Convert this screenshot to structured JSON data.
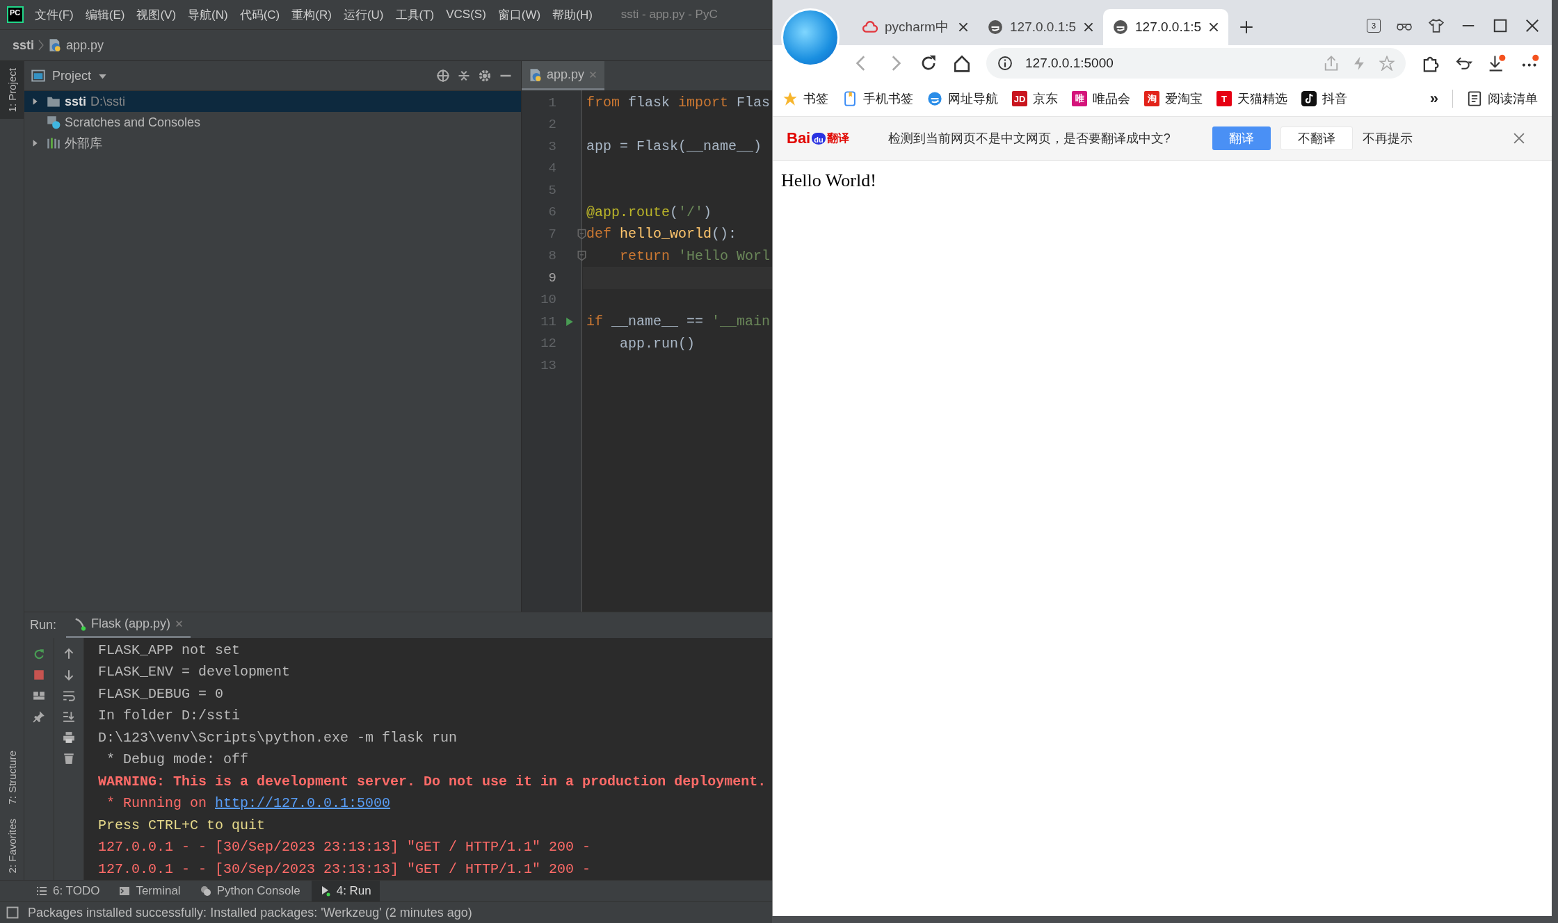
{
  "ide": {
    "logo": "PC",
    "menu": [
      "文件(F)",
      "编辑(E)",
      "视图(V)",
      "导航(N)",
      "代码(C)",
      "重构(R)",
      "运行(U)",
      "工具(T)",
      "VCS(S)",
      "窗口(W)",
      "帮助(H)"
    ],
    "title": "ssti - app.py - PyC",
    "breadcrumb": [
      "ssti",
      "app.py"
    ],
    "left_stripe_top": [
      {
        "label": "1: Project",
        "selected": true
      }
    ],
    "left_stripe_bottom": [
      {
        "label": "7: Structure",
        "selected": false
      },
      {
        "label": "2: Favorites",
        "selected": false
      }
    ],
    "project": {
      "title": "Project",
      "tree": [
        {
          "kind": "folder",
          "name": "ssti",
          "path": "D:\\ssti",
          "expanded": false,
          "selected": true
        },
        {
          "kind": "scratches",
          "name": "Scratches and Consoles",
          "selected": false
        },
        {
          "kind": "library",
          "name": "外部库",
          "expanded": false,
          "selected": false
        }
      ]
    },
    "editor": {
      "tab": "app.py",
      "lines": [
        {
          "kind": "plain",
          "number": "1",
          "current": false,
          "tokens": [
            {
              "kind": "keyword",
              "text": "from"
            },
            {
              "kind": "plain",
              "text": " flask "
            },
            {
              "kind": "keyword",
              "text": "import"
            },
            {
              "kind": "plain",
              "text": " Flas"
            }
          ]
        },
        {
          "kind": "plain",
          "number": "2",
          "current": false
        },
        {
          "kind": "plain",
          "number": "3",
          "current": false,
          "tokens": [
            {
              "kind": "plain",
              "text": "app = Flask(__name__)"
            }
          ]
        },
        {
          "kind": "plain",
          "number": "4",
          "current": false
        },
        {
          "kind": "plain",
          "number": "5",
          "current": false
        },
        {
          "kind": "plain",
          "number": "6",
          "current": false,
          "tokens": [
            {
              "kind": "decorator",
              "text": "@app.route"
            },
            {
              "kind": "plain",
              "text": "("
            },
            {
              "kind": "string",
              "text": "'/'"
            },
            {
              "kind": "plain",
              "text": ")"
            }
          ]
        },
        {
          "kind": "fold",
          "number": "7",
          "current": false,
          "tokens": [
            {
              "kind": "keyword",
              "text": "def "
            },
            {
              "kind": "function",
              "text": "hello_world"
            },
            {
              "kind": "plain",
              "text": "():"
            }
          ]
        },
        {
          "kind": "fold",
          "number": "8",
          "current": false,
          "tokens": [
            {
              "kind": "keyword",
              "text": "    return "
            },
            {
              "kind": "string",
              "text": "'Hello Worl"
            }
          ]
        },
        {
          "kind": "plain",
          "number": "9",
          "current": true
        },
        {
          "kind": "plain",
          "number": "10",
          "current": false
        },
        {
          "kind": "run",
          "number": "11",
          "current": false,
          "tokens": [
            {
              "kind": "keyword",
              "text": "if"
            },
            {
              "kind": "plain",
              "text": " __name__ == "
            },
            {
              "kind": "string",
              "text": "'__main"
            }
          ]
        },
        {
          "kind": "plain",
          "number": "12",
          "current": false,
          "tokens": [
            {
              "kind": "plain",
              "text": "    app.run()"
            }
          ]
        },
        {
          "kind": "plain",
          "number": "13",
          "current": false
        }
      ]
    },
    "run": {
      "label": "Run:",
      "tab": "Flask (app.py)",
      "console": [
        {
          "kind": "normal",
          "text": "FLASK_APP not set"
        },
        {
          "kind": "normal",
          "text": "FLASK_ENV = development"
        },
        {
          "kind": "normal",
          "text": "FLASK_DEBUG = 0"
        },
        {
          "kind": "normal",
          "text": "In folder D:/ssti"
        },
        {
          "kind": "normal",
          "text": "D:\\123\\venv\\Scripts\\python.exe -m flask run"
        },
        {
          "kind": "normal",
          "text": " * Debug mode: off"
        },
        {
          "kind": "warning",
          "text": "WARNING: This is a development server. Do not use it in a production deployment."
        },
        {
          "kind": "running",
          "text": " * Running on ",
          "link": "http://127.0.0.1:5000"
        },
        {
          "kind": "prompt",
          "text": "Press CTRL+C to quit"
        },
        {
          "kind": "log",
          "text": "127.0.0.1 - - [30/Sep/2023 23:13:13] \"GET / HTTP/1.1\" 200 -"
        },
        {
          "kind": "log",
          "text": "127.0.0.1 - - [30/Sep/2023 23:13:13] \"GET / HTTP/1.1\" 200 -"
        }
      ]
    },
    "tool_tabs": [
      {
        "kind": "todo",
        "label": "6: TODO",
        "selected": false
      },
      {
        "kind": "terminal",
        "label": "Terminal",
        "selected": false
      },
      {
        "kind": "python",
        "label": "Python Console",
        "selected": false
      },
      {
        "kind": "run",
        "label": "4: Run",
        "selected": true
      }
    ],
    "status_bar": "Packages installed successfully: Installed packages: 'Werkzeug' (2 minutes ago)"
  },
  "browser": {
    "tabs": [
      {
        "kind": "cloud",
        "title": "pycharm中",
        "selected": false
      },
      {
        "kind": "page",
        "title": "127.0.0.1:5",
        "selected": false
      },
      {
        "kind": "page",
        "title": "127.0.0.1:5",
        "selected": true
      }
    ],
    "tab_count": "3",
    "address": "127.0.0.1:5000",
    "bookmarks": [
      {
        "kind": "star",
        "label": "书签"
      },
      {
        "kind": "phone",
        "label": "手机书签"
      },
      {
        "kind": "nav",
        "label": "网址导航"
      },
      {
        "kind": "badge",
        "icon_text": "JD",
        "color": "#c9151e",
        "label": "京东"
      },
      {
        "kind": "badge",
        "icon_text": "唯",
        "color": "#d4147a",
        "label": "唯品会"
      },
      {
        "kind": "badge",
        "icon_text": "淘",
        "color": "#e2231a",
        "label": "爱淘宝"
      },
      {
        "kind": "badge",
        "icon_text": "T",
        "color": "#e60012",
        "label": "天猫精选"
      },
      {
        "kind": "tiktok",
        "label": "抖音"
      }
    ],
    "more": "»",
    "reading_list": "阅读清单",
    "translate": {
      "logo": [
        "Bai",
        "du",
        "翻译"
      ],
      "message": "检测到当前网页不是中文网页，是否要翻译成中文?",
      "buttons": [
        {
          "kind": "primary",
          "label": "翻译"
        },
        {
          "kind": "secondary",
          "label": "不翻译"
        },
        {
          "kind": "text",
          "label": "不再提示"
        }
      ]
    },
    "content": "Hello World!"
  }
}
